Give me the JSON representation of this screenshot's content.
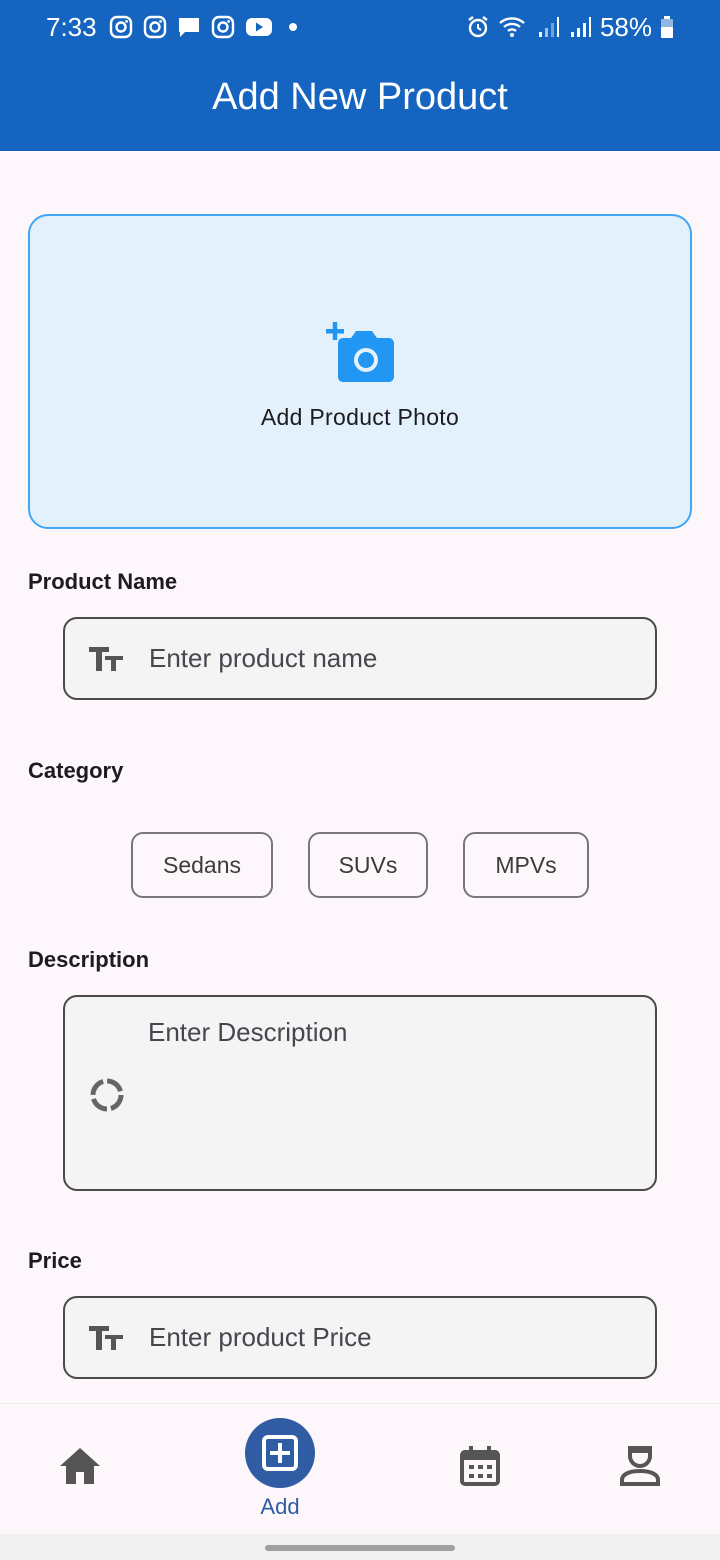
{
  "status_bar": {
    "time": "7:33",
    "battery": "58%",
    "icons_left": [
      "instagram-icon",
      "instagram-icon",
      "message-icon",
      "instagram-icon",
      "youtube-icon"
    ],
    "icons_right": [
      "alarm-icon",
      "wifi-icon",
      "signal-icon",
      "signal-icon",
      "battery-icon"
    ]
  },
  "header": {
    "title": "Add New Product"
  },
  "photo": {
    "label": "Add Product Photo",
    "icon": "add-camera-icon"
  },
  "form": {
    "name_label": "Product Name",
    "name_placeholder": "Enter product name",
    "category_label": "Category",
    "categories": [
      "Sedans",
      "SUVs",
      "MPVs"
    ],
    "description_label": "Description",
    "description_placeholder": "Enter Description",
    "price_label": "Price",
    "price_placeholder": "Enter product Price"
  },
  "nav": {
    "items": [
      {
        "icon": "home-icon",
        "label": ""
      },
      {
        "icon": "add-box-icon",
        "label": "Add"
      },
      {
        "icon": "calendar-icon",
        "label": ""
      },
      {
        "icon": "person-icon",
        "label": ""
      }
    ]
  },
  "colors": {
    "primary": "#1565c0",
    "nav_active": "#2f5ca3",
    "photo_bg": "#e3f1fc",
    "photo_border": "#42a5f5"
  }
}
